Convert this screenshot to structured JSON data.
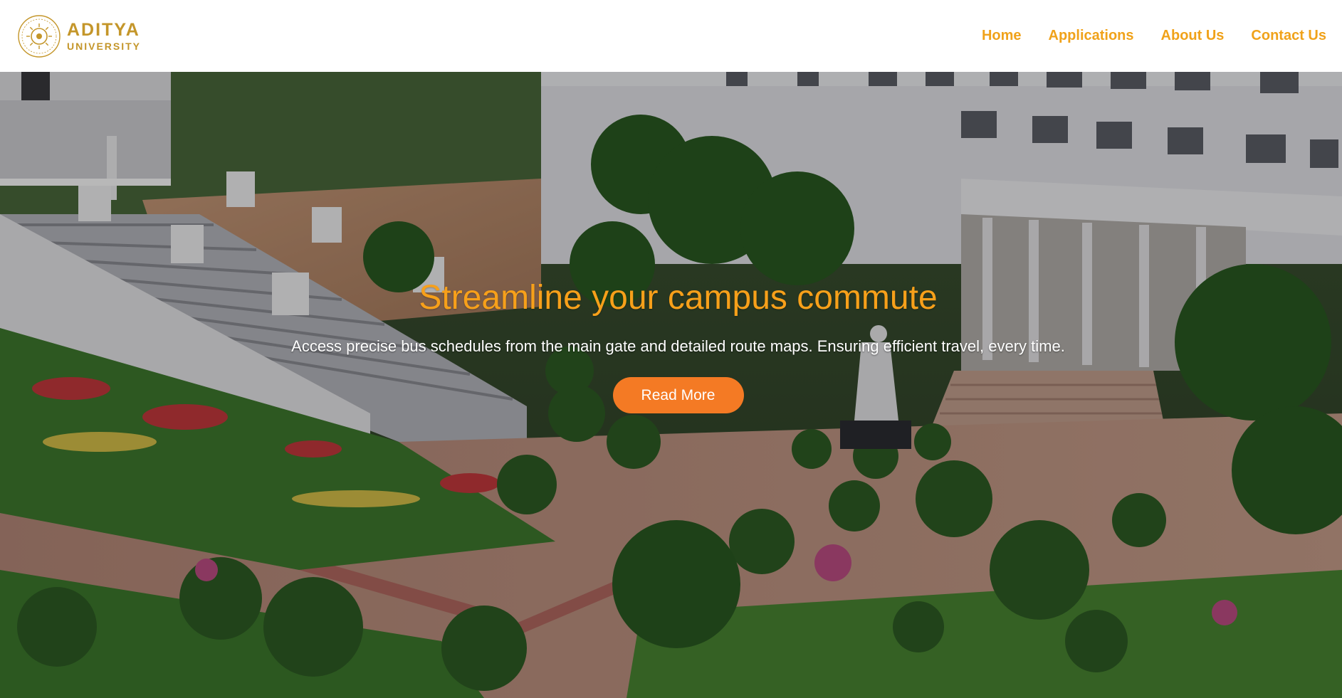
{
  "brand": {
    "name_line1": "ADITYA",
    "name_line2": "UNIVERSITY",
    "color": "#c4962a"
  },
  "nav": {
    "items": [
      {
        "label": "Home"
      },
      {
        "label": "Applications"
      },
      {
        "label": "About Us"
      },
      {
        "label": "Contact Us"
      }
    ],
    "color": "#f0a21a"
  },
  "hero": {
    "background": "campus photo: buildings, stepped amphitheater, landscaped gardens with topiary and flowers, paved walkways, statue",
    "title": "Streamline your campus commute",
    "subtitle": "Access precise bus schedules from the main gate and detailed route maps. Ensuring efficient travel, every time.",
    "button_label": "Read More",
    "title_color": "#f7a01a",
    "button_color": "#f47a24"
  }
}
